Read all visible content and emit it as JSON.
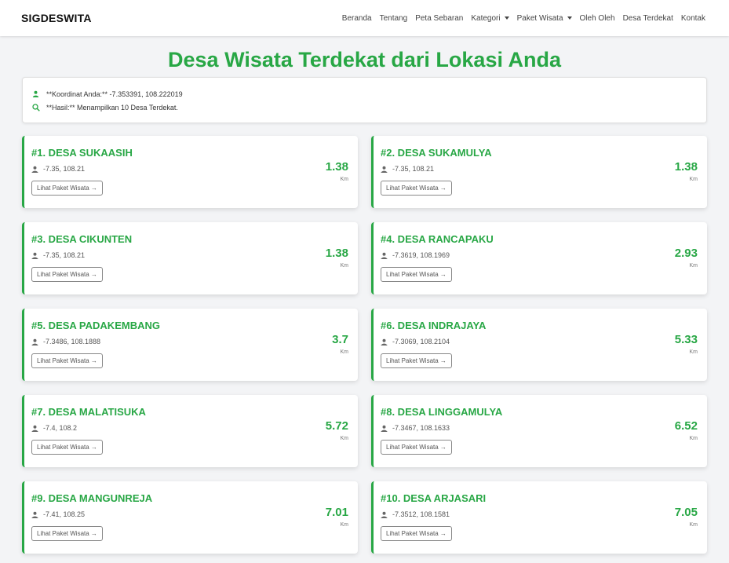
{
  "navbar": {
    "brand": "SIGDESWITA",
    "items": [
      {
        "label": "Beranda",
        "dropdown": false
      },
      {
        "label": "Tentang",
        "dropdown": false
      },
      {
        "label": "Peta Sebaran",
        "dropdown": false
      },
      {
        "label": "Kategori",
        "dropdown": true
      },
      {
        "label": "Paket Wisata",
        "dropdown": true
      },
      {
        "label": "Oleh Oleh",
        "dropdown": false
      },
      {
        "label": "Desa Terdekat",
        "dropdown": false
      },
      {
        "label": "Kontak",
        "dropdown": false
      }
    ]
  },
  "page": {
    "title": "Desa Wisata Terdekat dari Lokasi Anda"
  },
  "info": {
    "coords_text": "**Koordinat Anda:** -7.353391, 108.222019",
    "result_text": "**Hasil:** Menampilkan 10 Desa Terdekat."
  },
  "colors": {
    "accent": "#28a745"
  },
  "cards": [
    {
      "title": "#1. DESA SUKAASIH",
      "coords": "-7.35, 108.21",
      "distance": "1.38",
      "unit": "Km",
      "button": "Lihat Paket Wisata →"
    },
    {
      "title": "#2. DESA SUKAMULYA",
      "coords": "-7.35, 108.21",
      "distance": "1.38",
      "unit": "Km",
      "button": "Lihat Paket Wisata →"
    },
    {
      "title": "#3. DESA CIKUNTEN",
      "coords": "-7.35, 108.21",
      "distance": "1.38",
      "unit": "Km",
      "button": "Lihat Paket Wisata →"
    },
    {
      "title": "#4. DESA RANCAPAKU",
      "coords": "-7.3619, 108.1969",
      "distance": "2.93",
      "unit": "Km",
      "button": "Lihat Paket Wisata →"
    },
    {
      "title": "#5. DESA PADAKEMBANG",
      "coords": "-7.3486, 108.1888",
      "distance": "3.7",
      "unit": "Km",
      "button": "Lihat Paket Wisata →"
    },
    {
      "title": "#6. DESA INDRAJAYA",
      "coords": "-7.3069, 108.2104",
      "distance": "5.33",
      "unit": "Km",
      "button": "Lihat Paket Wisata →"
    },
    {
      "title": "#7. DESA MALATISUKA",
      "coords": "-7.4, 108.2",
      "distance": "5.72",
      "unit": "Km",
      "button": "Lihat Paket Wisata →"
    },
    {
      "title": "#8. DESA LINGGAMULYA",
      "coords": "-7.3467, 108.1633",
      "distance": "6.52",
      "unit": "Km",
      "button": "Lihat Paket Wisata →"
    },
    {
      "title": "#9. DESA MANGUNREJA",
      "coords": "-7.41, 108.25",
      "distance": "7.01",
      "unit": "Km",
      "button": "Lihat Paket Wisata →"
    },
    {
      "title": "#10. DESA ARJASARI",
      "coords": "-7.3512, 108.1581",
      "distance": "7.05",
      "unit": "Km",
      "button": "Lihat Paket Wisata →"
    }
  ]
}
